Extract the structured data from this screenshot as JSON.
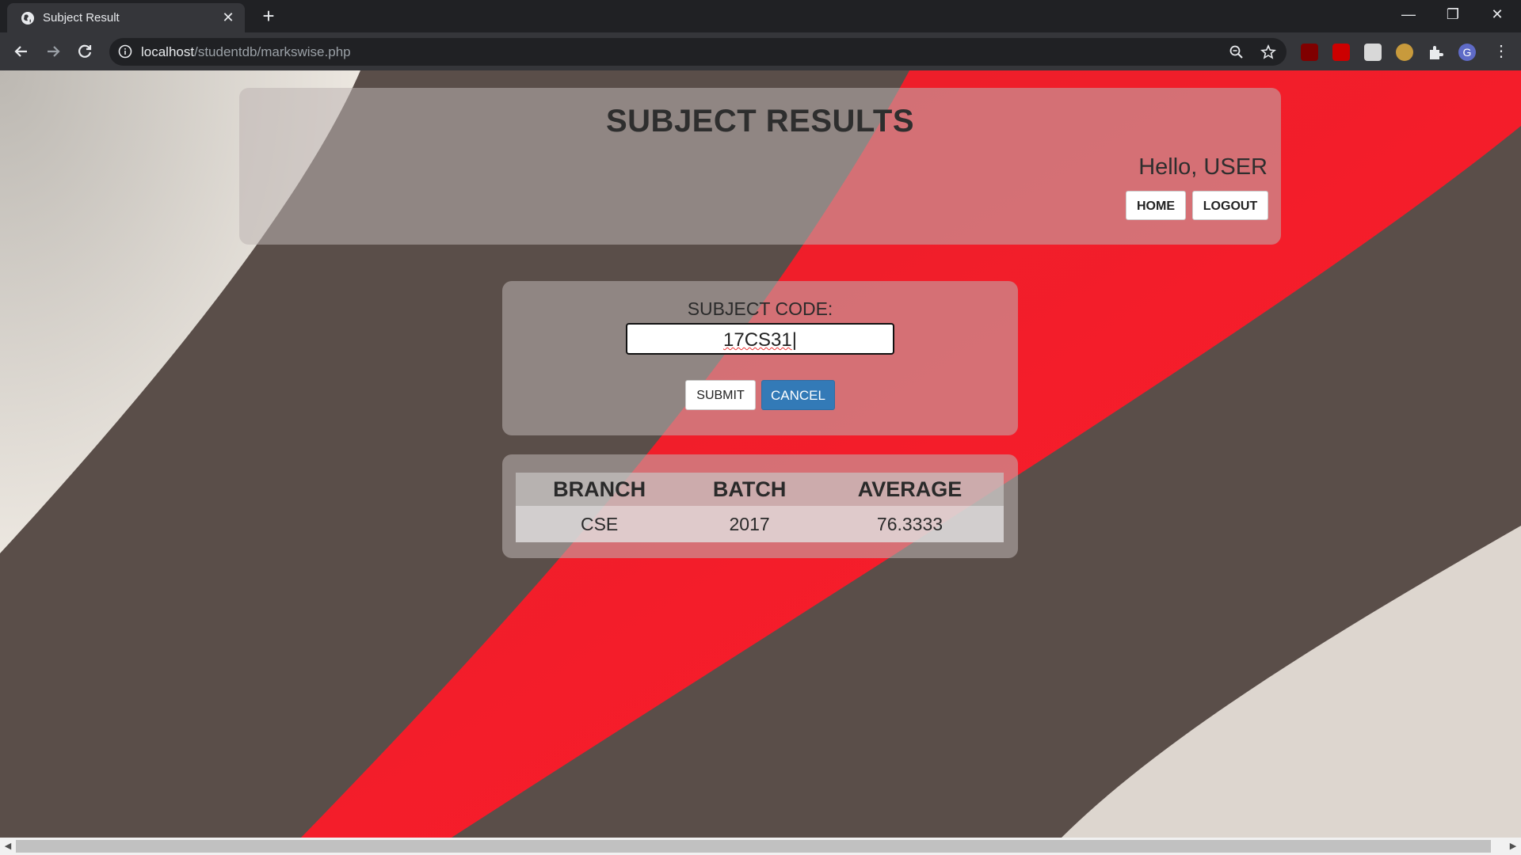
{
  "browser": {
    "tab_title": "Subject Result",
    "tab_close": "✕",
    "new_tab": "+",
    "url_host": "localhost",
    "url_path": "/studentdb/markswise.php",
    "window_controls": [
      "—",
      "❐",
      "✕"
    ]
  },
  "header": {
    "title": "SUBJECT RESULTS",
    "greeting": "Hello, USER",
    "home_label": "HOME",
    "logout_label": "LOGOUT"
  },
  "form": {
    "label": "SUBJECT CODE:",
    "input_value": "17CS31",
    "submit_label": "SUBMIT",
    "cancel_label": "CANCEL"
  },
  "results": {
    "columns": [
      "BRANCH",
      "BATCH",
      "AVERAGE"
    ],
    "rows": [
      [
        "CSE",
        "2017",
        "76.3333"
      ]
    ]
  },
  "colors": {
    "background_red": "#ff1b2d",
    "background_dark": "#5b4f4a",
    "cancel_button": "#337ab7"
  }
}
